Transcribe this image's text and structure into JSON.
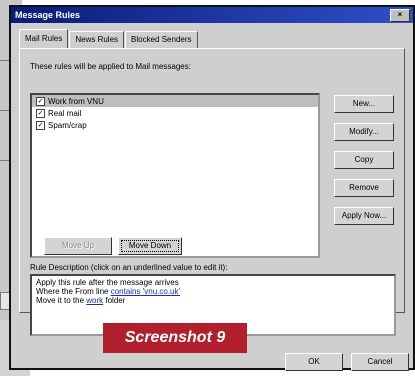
{
  "window": {
    "title": "Message Rules",
    "close_label": "×"
  },
  "tabs": [
    "Mail Rules",
    "News Rules",
    "Blocked Senders"
  ],
  "intro_text": "These rules will be applied to Mail messages:",
  "rules": [
    {
      "label": "Work from VNU",
      "checked": true,
      "selected": true
    },
    {
      "label": "Real mail",
      "checked": true,
      "selected": false
    },
    {
      "label": "Spam/crap",
      "checked": true,
      "selected": false
    }
  ],
  "side_buttons": {
    "new": "New...",
    "modify": "Modify...",
    "copy": "Copy",
    "remove": "Remove",
    "apply": "Apply Now..."
  },
  "move_buttons": {
    "up": "Move Up",
    "down": "Move Down"
  },
  "description": {
    "label": "Rule Description (click on an underlined value to edit it):",
    "line1": "Apply this rule after the message arrives",
    "line2_prefix": "Where the From line ",
    "line2_link": "contains 'vnu.co.uk'",
    "line3_prefix": "Move it to the ",
    "line3_link": "work",
    "line3_suffix": " folder"
  },
  "footer": {
    "ok": "OK",
    "cancel": "Cancel"
  },
  "caption": "Screenshot 9"
}
